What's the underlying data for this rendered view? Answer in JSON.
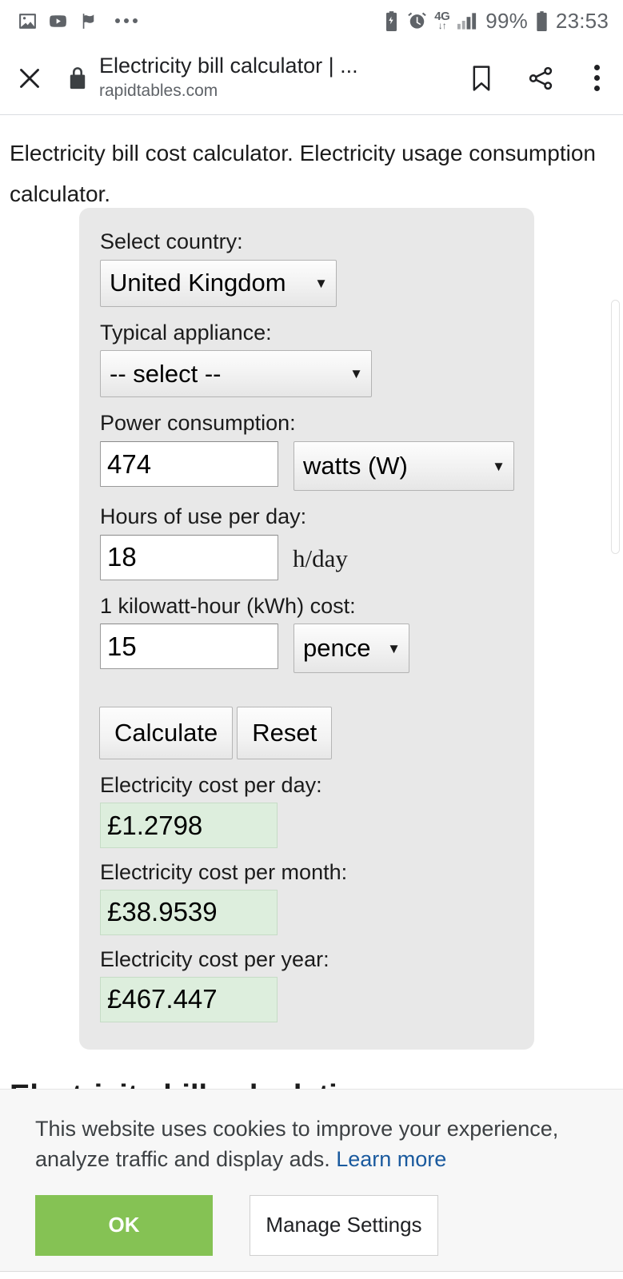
{
  "status_bar": {
    "left_icons": [
      "image-icon",
      "youtube-icon",
      "flag-icon",
      "more-icon"
    ],
    "right_icons": [
      "battery-saver-icon",
      "alarm-icon",
      "network-4g-icon",
      "signal-bars-icon",
      "battery-icon"
    ],
    "network_label": "4G",
    "network_arrows": "↓↑",
    "battery_percent": "99%",
    "clock": "23:53"
  },
  "toolbar": {
    "close_icon": "close-icon",
    "lock_icon": "lock-icon",
    "page_title": "Electricity bill calculator | ...",
    "host": "rapidtables.com",
    "bookmark_icon": "bookmark-icon",
    "share_icon": "share-icon",
    "overflow_icon": "overflow-menu-icon"
  },
  "page": {
    "intro": "Electricity bill cost calculator. Electricity usage consumption calculator.",
    "section_heading": "Electricity bill calculation"
  },
  "calculator": {
    "country": {
      "label": "Select country:",
      "value": "United Kingdom",
      "arrow": "▼"
    },
    "appliance": {
      "label": "Typical appliance:",
      "value": "-- select --",
      "arrow": "▼"
    },
    "power": {
      "label": "Power consumption:",
      "value": "474",
      "unit": "watts (W)",
      "arrow": "▼"
    },
    "hours": {
      "label": "Hours of use per day:",
      "value": "18",
      "unit": "h/day"
    },
    "kwh_cost": {
      "label": "1 kilowatt-hour (kWh) cost:",
      "value": "15",
      "unit": "pence",
      "arrow": "▼"
    },
    "buttons": {
      "calculate": "Calculate",
      "reset": "Reset"
    },
    "results": [
      {
        "label": "Electricity cost per day:",
        "value": "£1.2798"
      },
      {
        "label": "Electricity cost per month:",
        "value": "£38.9539"
      },
      {
        "label": "Electricity cost per year:",
        "value": "£467.447"
      }
    ]
  },
  "cookie_banner": {
    "text": "This website uses cookies to improve your experience, analyze traffic and display ads.",
    "link": "Learn more",
    "ok_label": "OK",
    "manage_label": "Manage Settings",
    "ok_color": "#85c254"
  }
}
